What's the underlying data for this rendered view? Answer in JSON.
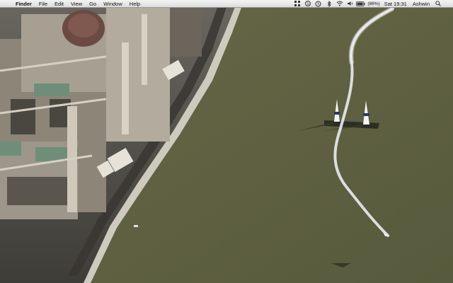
{
  "menubar": {
    "apple_glyph": "",
    "items": [
      "Finder",
      "File",
      "Edit",
      "View",
      "Go",
      "Window",
      "Help"
    ],
    "status": {
      "battery_percent": "(86%)",
      "clock": "Sat 19:31",
      "user": "Ashwin"
    }
  },
  "desktop": {
    "wallpaper": "aerial-river-race-photo",
    "colors": {
      "river": "#5f6042",
      "bank": "#c9c4b8",
      "smoke": "#e8ecef"
    }
  }
}
